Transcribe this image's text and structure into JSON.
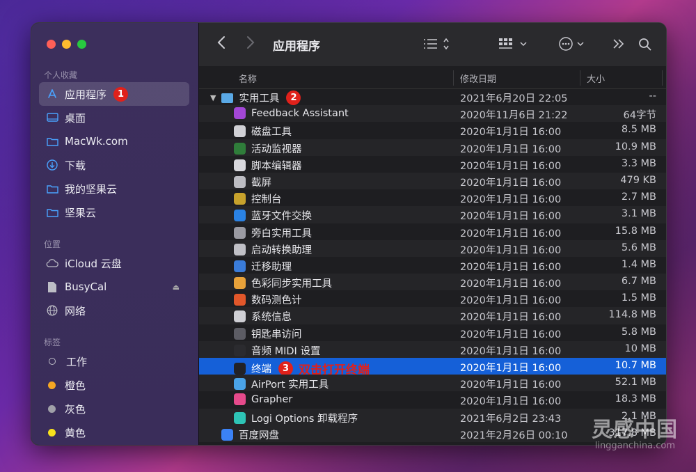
{
  "window": {
    "title": "应用程序"
  },
  "sidebar": {
    "favorites_title": "个人收藏",
    "favorites": [
      {
        "label": "应用程序",
        "icon": "app-store-icon",
        "badge": "1",
        "selected": true
      },
      {
        "label": "桌面",
        "icon": "desktop-icon"
      },
      {
        "label": "MacWk.com",
        "icon": "folder-icon"
      },
      {
        "label": "下载",
        "icon": "download-icon"
      },
      {
        "label": "我的坚果云",
        "icon": "folder-icon"
      },
      {
        "label": "坚果云",
        "icon": "folder-icon"
      }
    ],
    "locations_title": "位置",
    "locations": [
      {
        "label": "iCloud 云盘",
        "icon": "cloud-icon"
      },
      {
        "label": "BusyCal",
        "icon": "document-icon"
      },
      {
        "label": "网络",
        "icon": "globe-icon"
      }
    ],
    "tags_title": "标签",
    "tags": [
      {
        "label": "工作",
        "color": ""
      },
      {
        "label": "橙色",
        "color": "#f5a623"
      },
      {
        "label": "灰色",
        "color": "#a0a0a8"
      },
      {
        "label": "黄色",
        "color": "#f8e11c"
      }
    ]
  },
  "columns": {
    "name": "名称",
    "date": "修改日期",
    "size": "大小"
  },
  "folder": {
    "name": "实用工具",
    "badge": "2",
    "date": "2021年6月20日 22:05",
    "size": "--"
  },
  "files": [
    {
      "name": "Feedback Assistant",
      "date": "2020年11月6日 21:22",
      "size": "64字节",
      "color": "#a347d6"
    },
    {
      "name": "磁盘工具",
      "date": "2020年1月1日 16:00",
      "size": "8.5 MB",
      "color": "#d0d0d5"
    },
    {
      "name": "活动监视器",
      "date": "2020年1月1日 16:00",
      "size": "10.9 MB",
      "color": "#2f7d3a"
    },
    {
      "name": "脚本编辑器",
      "date": "2020年1月1日 16:00",
      "size": "3.3 MB",
      "color": "#d8d8dd"
    },
    {
      "name": "截屏",
      "date": "2020年1月1日 16:00",
      "size": "479 KB",
      "color": "#bcbcc2"
    },
    {
      "name": "控制台",
      "date": "2020年1月1日 16:00",
      "size": "2.7 MB",
      "color": "#c7a22c"
    },
    {
      "name": "蓝牙文件交换",
      "date": "2020年1月1日 16:00",
      "size": "3.1 MB",
      "color": "#2a82e4"
    },
    {
      "name": "旁白实用工具",
      "date": "2020年1月1日 16:00",
      "size": "15.8 MB",
      "color": "#9a9aa2"
    },
    {
      "name": "启动转换助理",
      "date": "2020年1月1日 16:00",
      "size": "5.6 MB",
      "color": "#c0c0c6"
    },
    {
      "name": "迁移助理",
      "date": "2020年1月1日 16:00",
      "size": "1.4 MB",
      "color": "#3a7cd9"
    },
    {
      "name": "色彩同步实用工具",
      "date": "2020年1月1日 16:00",
      "size": "6.7 MB",
      "color": "#e8a23a"
    },
    {
      "name": "数码测色计",
      "date": "2020年1月1日 16:00",
      "size": "1.5 MB",
      "color": "#e2572a"
    },
    {
      "name": "系统信息",
      "date": "2020年1月1日 16:00",
      "size": "114.8 MB",
      "color": "#cfcfd4"
    },
    {
      "name": "钥匙串访问",
      "date": "2020年1月1日 16:00",
      "size": "5.8 MB",
      "color": "#5c5c64"
    },
    {
      "name": "音频 MIDI 设置",
      "date": "2020年1月1日 16:00",
      "size": "10 MB",
      "color": "#2b2b2f"
    },
    {
      "name": "终端",
      "date": "2020年1月1日 16:00",
      "size": "10.7 MB",
      "color": "#222226",
      "selected": true,
      "badge": "3",
      "annotation": "双击打开终端"
    },
    {
      "name": "AirPort 实用工具",
      "date": "2020年1月1日 16:00",
      "size": "52.1 MB",
      "color": "#4aa3e8"
    },
    {
      "name": "Grapher",
      "date": "2020年1月1日 16:00",
      "size": "18.3 MB",
      "color": "#e64a8b"
    },
    {
      "name": "Logi Options 卸载程序",
      "date": "2021年6月2日 23:43",
      "size": "2.1 MB",
      "color": "#2ec4b6"
    }
  ],
  "after": {
    "name": "百度网盘",
    "date": "2021年2月26日 00:10",
    "size": "317.8 MB",
    "color": "#3b82f6"
  },
  "watermark": {
    "logo": "灵感中国",
    "site": "lingganchina.com"
  }
}
